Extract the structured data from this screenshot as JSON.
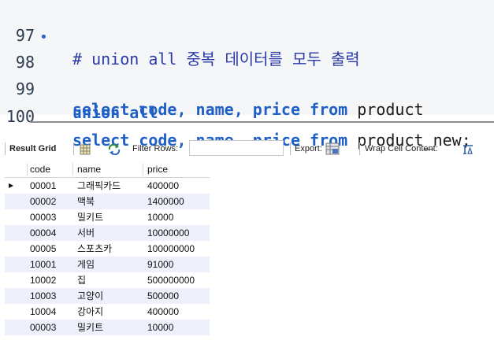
{
  "editor": {
    "lines": [
      {
        "num": "97",
        "marker": "",
        "comment": "# union all 중복 데이터를 모두 출력"
      },
      {
        "num": "98",
        "marker": "•",
        "kw_select": "select",
        "cols": " code, name, price ",
        "kw_from": "from",
        "table": " product"
      },
      {
        "num": "99",
        "marker": "",
        "kw_union": "union all"
      },
      {
        "num": "100",
        "marker": "",
        "kw_select": "select",
        "cols": " code, name, price ",
        "kw_from": "from",
        "table": " product_new;"
      }
    ]
  },
  "toolbar": {
    "result_grid_label": "Result Grid",
    "filter_label": "Filter Rows:",
    "filter_value": "",
    "export_label": "Export:",
    "wrap_label": "Wrap Cell Content:"
  },
  "grid": {
    "columns": [
      "code",
      "name",
      "price"
    ],
    "rows": [
      {
        "code": "00001",
        "name": "그래픽카드",
        "price": "400000"
      },
      {
        "code": "00002",
        "name": "맥북",
        "price": "1400000"
      },
      {
        "code": "00003",
        "name": "밀키트",
        "price": "10000"
      },
      {
        "code": "00004",
        "name": "서버",
        "price": "10000000"
      },
      {
        "code": "00005",
        "name": "스포츠카",
        "price": "100000000"
      },
      {
        "code": "10001",
        "name": "게임",
        "price": "91000"
      },
      {
        "code": "10002",
        "name": "집",
        "price": "500000000"
      },
      {
        "code": "10003",
        "name": "고양이",
        "price": "500000"
      },
      {
        "code": "10004",
        "name": "강아지",
        "price": "400000"
      },
      {
        "code": "00003",
        "name": "밀키트",
        "price": "10000"
      }
    ],
    "selected_row_marker": "▶"
  },
  "colors": {
    "keyword": "#1f5fc6",
    "comment": "#2a3ba8",
    "row_alt": "#eef1fb",
    "editor_bg": "#f5f6f7"
  },
  "icons": [
    "grid-view-icon",
    "refresh-icon",
    "export-icon",
    "wrap-cell-icon"
  ]
}
